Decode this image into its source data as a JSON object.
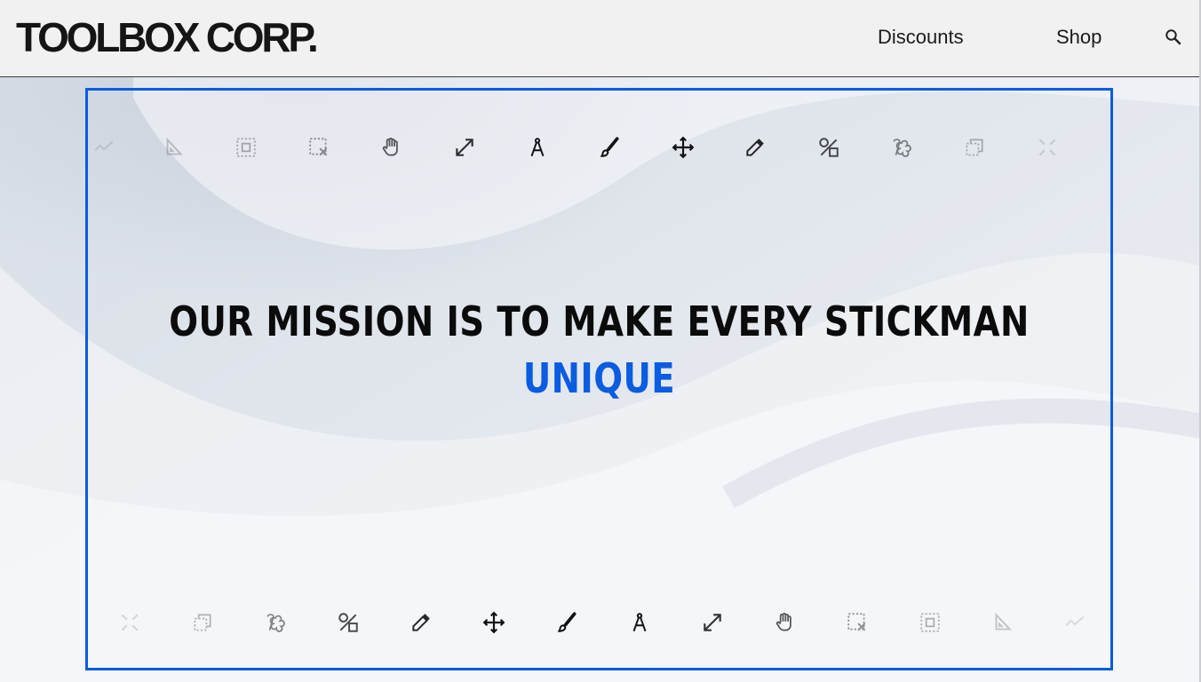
{
  "brand": {
    "logo_text": "TOOLBOX CORP."
  },
  "nav": {
    "items": [
      {
        "label": "Discounts"
      },
      {
        "label": "Shop"
      }
    ],
    "search_icon": "search-icon"
  },
  "hero": {
    "headline": "OUR MISSION IS TO MAKE EVERY STICKMAN",
    "accent_word": "UNIQUE",
    "accent_color": "#0a5ce0",
    "frame_color": "#0a5ce0"
  },
  "icon_rows": {
    "top": [
      "trend-line-icon",
      "set-square-icon",
      "select-frame-icon",
      "deselect-icon",
      "hand-icon",
      "resize-icon",
      "compass-icon",
      "brush-icon",
      "move-icon",
      "eyedropper-icon",
      "shapes-icon",
      "lasso-icon",
      "copy-icon",
      "collapse-icon"
    ],
    "bottom": [
      "collapse-icon",
      "copy-icon",
      "lasso-icon",
      "shapes-icon",
      "eyedropper-icon",
      "move-icon",
      "brush-icon",
      "compass-icon",
      "resize-icon",
      "hand-icon",
      "deselect-icon",
      "select-frame-icon",
      "set-square-icon",
      "trend-line-icon"
    ]
  }
}
